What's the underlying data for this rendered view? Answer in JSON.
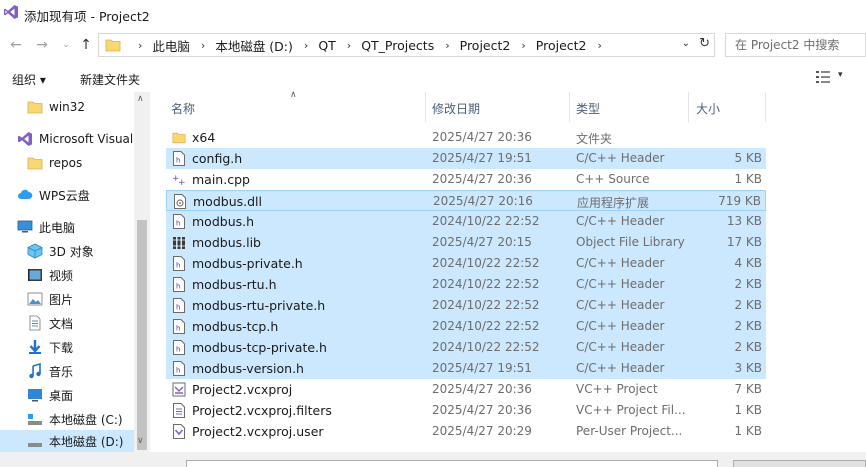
{
  "window": {
    "title": "添加现有项 - Project2"
  },
  "address": {
    "crumbs": [
      "此电脑",
      "本地磁盘 (D:)",
      "QT",
      "QT_Projects",
      "Project2",
      "Project2"
    ],
    "separator": "›"
  },
  "search": {
    "placeholder": "在 Project2 中搜索"
  },
  "toolbar": {
    "organize_label": "组织 ▾",
    "new_folder_label": "新建文件夹"
  },
  "sidebar": {
    "items": [
      {
        "label": "win32",
        "icon": "folder-icon"
      },
      {
        "label": "Microsoft Visual",
        "icon": "visual-studio-icon"
      },
      {
        "label": "repos",
        "icon": "folder-icon"
      },
      {
        "label": "WPS云盘",
        "icon": "cloud-icon"
      },
      {
        "label": "此电脑",
        "icon": "computer-icon"
      },
      {
        "label": "3D 对象",
        "icon": "3d-objects-icon"
      },
      {
        "label": "视频",
        "icon": "video-icon"
      },
      {
        "label": "图片",
        "icon": "pictures-icon"
      },
      {
        "label": "文档",
        "icon": "documents-icon"
      },
      {
        "label": "下载",
        "icon": "download-icon"
      },
      {
        "label": "音乐",
        "icon": "music-icon"
      },
      {
        "label": "桌面",
        "icon": "desktop-icon"
      },
      {
        "label": "本地磁盘 (C:)",
        "icon": "drive-icon"
      },
      {
        "label": "本地磁盘 (D:)",
        "icon": "drive-icon"
      }
    ]
  },
  "columns": {
    "name": "名称",
    "date": "修改日期",
    "type": "类型",
    "size": "大小"
  },
  "files": [
    {
      "name": "x64",
      "date": "2025/4/27 20:36",
      "type": "文件夹",
      "size": "",
      "icon": "folder-icon",
      "selected": false
    },
    {
      "name": "config.h",
      "date": "2025/4/27 19:51",
      "type": "C/C++ Header",
      "size": "5 KB",
      "icon": "header-file-icon",
      "selected": true
    },
    {
      "name": "main.cpp",
      "date": "2025/4/27 20:36",
      "type": "C++ Source",
      "size": "1 KB",
      "icon": "cpp-file-icon",
      "selected": false
    },
    {
      "name": "modbus.dll",
      "date": "2025/4/27 20:16",
      "type": "应用程序扩展",
      "size": "719 KB",
      "icon": "dll-file-icon",
      "selected": true
    },
    {
      "name": "modbus.h",
      "date": "2024/10/22 22:52",
      "type": "C/C++ Header",
      "size": "13 KB",
      "icon": "header-file-icon",
      "selected": true
    },
    {
      "name": "modbus.lib",
      "date": "2025/4/27 20:15",
      "type": "Object File Library",
      "size": "17 KB",
      "icon": "lib-file-icon",
      "selected": true
    },
    {
      "name": "modbus-private.h",
      "date": "2024/10/22 22:52",
      "type": "C/C++ Header",
      "size": "4 KB",
      "icon": "header-file-icon",
      "selected": true
    },
    {
      "name": "modbus-rtu.h",
      "date": "2024/10/22 22:52",
      "type": "C/C++ Header",
      "size": "2 KB",
      "icon": "header-file-icon",
      "selected": true
    },
    {
      "name": "modbus-rtu-private.h",
      "date": "2024/10/22 22:52",
      "type": "C/C++ Header",
      "size": "2 KB",
      "icon": "header-file-icon",
      "selected": true
    },
    {
      "name": "modbus-tcp.h",
      "date": "2024/10/22 22:52",
      "type": "C/C++ Header",
      "size": "2 KB",
      "icon": "header-file-icon",
      "selected": true
    },
    {
      "name": "modbus-tcp-private.h",
      "date": "2024/10/22 22:52",
      "type": "C/C++ Header",
      "size": "2 KB",
      "icon": "header-file-icon",
      "selected": true
    },
    {
      "name": "modbus-version.h",
      "date": "2025/4/27 19:51",
      "type": "C/C++ Header",
      "size": "3 KB",
      "icon": "header-file-icon",
      "selected": true
    },
    {
      "name": "Project2.vcxproj",
      "date": "2025/4/27 20:36",
      "type": "VC++ Project",
      "size": "7 KB",
      "icon": "vcxproj-file-icon",
      "selected": false
    },
    {
      "name": "Project2.vcxproj.filters",
      "date": "2025/4/27 20:36",
      "type": "VC++ Project Fil...",
      "size": "1 KB",
      "icon": "filters-file-icon",
      "selected": false
    },
    {
      "name": "Project2.vcxproj.user",
      "date": "2025/4/27 20:29",
      "type": "Per-User Project...",
      "size": "1 KB",
      "icon": "user-file-icon",
      "selected": false
    }
  ],
  "colors": {
    "selection": "#cce8ff",
    "focus_border": "#99d1ff",
    "header_text": "#4c607a",
    "folder": "#f8d775"
  }
}
